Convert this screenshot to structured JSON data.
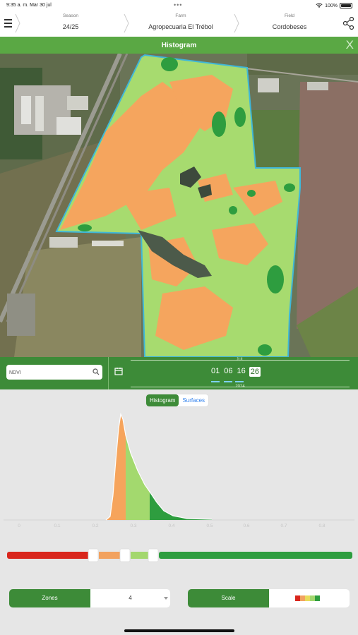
{
  "status": {
    "time_date": "9:35 a. m.   Mar 30 jul",
    "dots": "•••",
    "battery": "100%"
  },
  "header": {
    "season": {
      "label": "Season",
      "value": "24/25"
    },
    "farm": {
      "label": "Farm",
      "value": "Agropecuaria El Trébol"
    },
    "field": {
      "label": "Field",
      "value": "Cordobeses"
    },
    "menu_icon": "hamburger-icon",
    "share_icon": "share-icon"
  },
  "titlebar": {
    "title": "Histogram",
    "close": "X"
  },
  "controls": {
    "search_value": "NDVI",
    "month": "JUL",
    "year": "2024",
    "days": [
      "01",
      "06",
      "16",
      "26"
    ],
    "selected_day": "26"
  },
  "tabs": {
    "histogram": "Histogram",
    "surfaces": "Surfaces"
  },
  "histogram": {
    "ticks": [
      "0",
      "0.1",
      "0.2",
      "0.3",
      "0.4",
      "0.5",
      "0.6",
      "0.7",
      "0.8",
      "0.9"
    ]
  },
  "zones": {
    "label": "Zones",
    "value": "4"
  },
  "scale": {
    "label": "Scale",
    "colors": [
      "#d9261c",
      "#f2a25f",
      "#a3d76e",
      "#2e9d3f"
    ]
  },
  "colors": {
    "brand_green": "#3d8b38",
    "bar_green": "#5aa844",
    "orange": "#f6a45c",
    "light_green": "#a3d96e",
    "dark_green": "#2e9d3f",
    "red": "#d9261c"
  }
}
